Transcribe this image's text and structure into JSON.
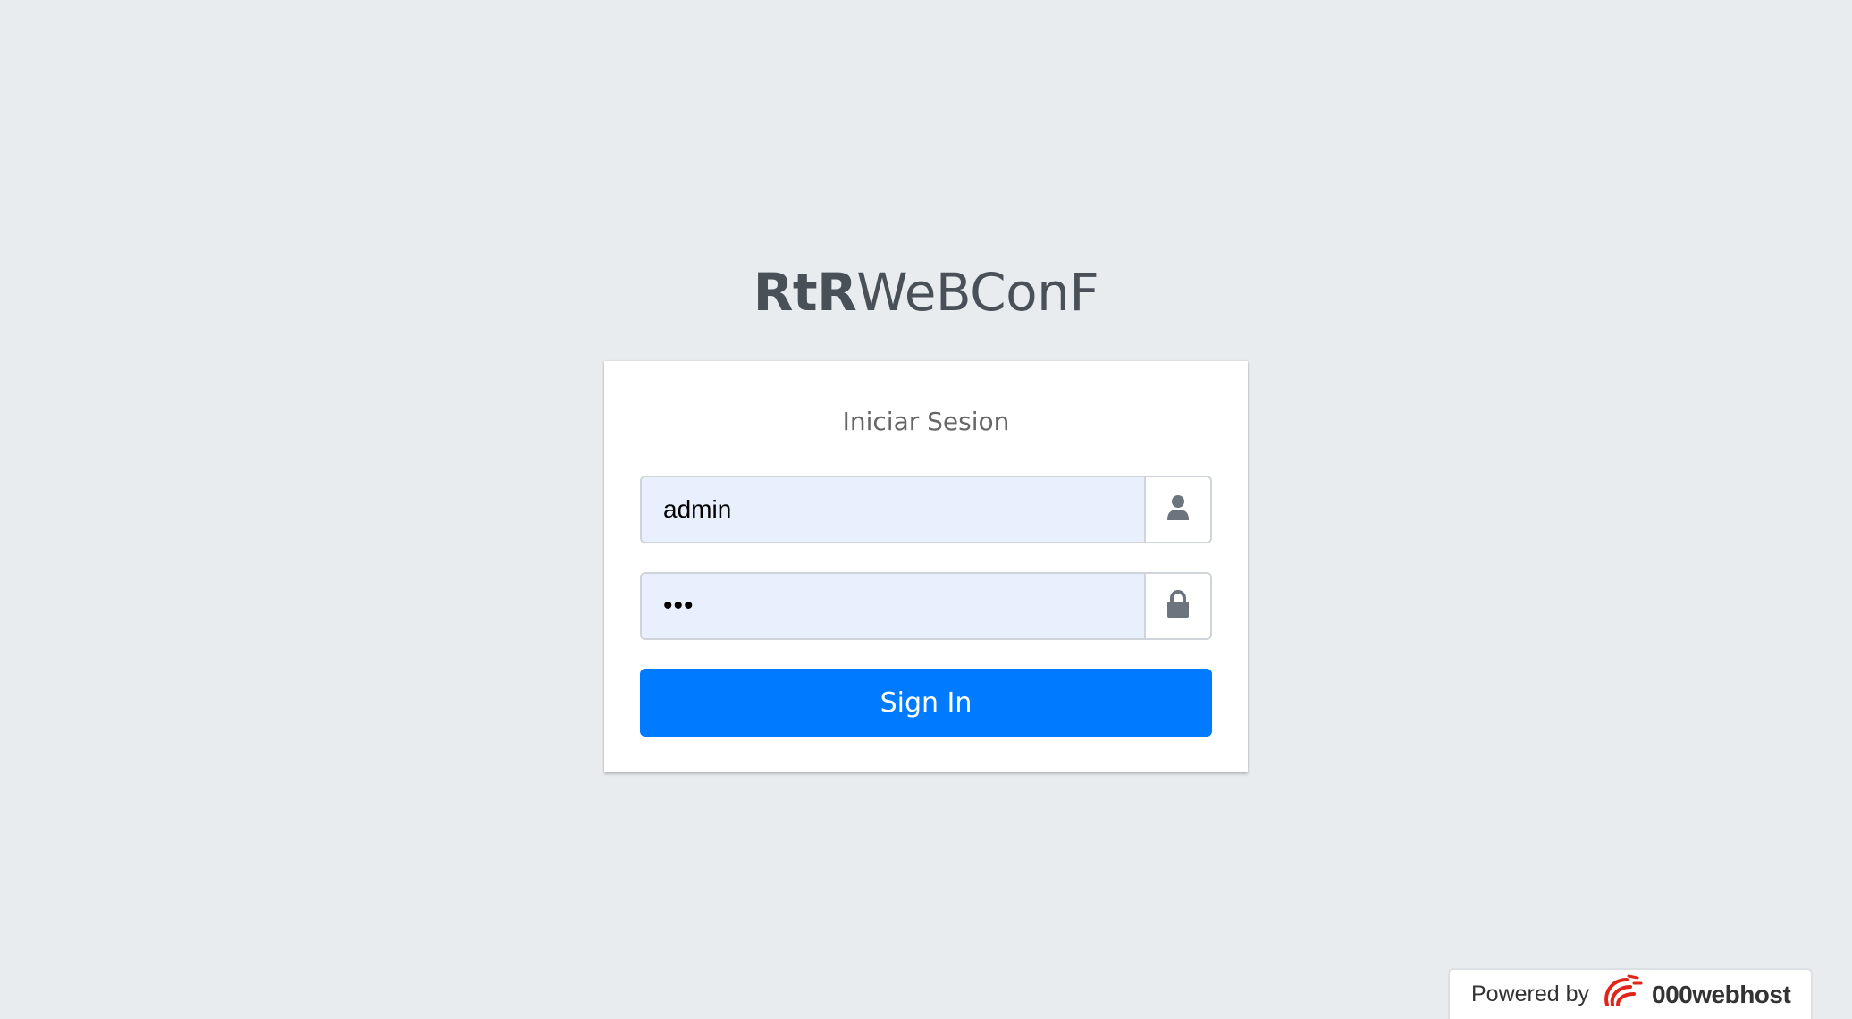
{
  "logo": {
    "bold_part": "RtR",
    "light_part": "WeBConF"
  },
  "login": {
    "message": "Iniciar Sesion",
    "username": {
      "value": "admin",
      "icon": "user-icon"
    },
    "password": {
      "value": "•••",
      "icon": "lock-icon"
    },
    "submit_label": "Sign In"
  },
  "footer": {
    "powered_label": "Powered by",
    "brand": "000webhost",
    "brand_color": "#e1251b"
  },
  "colors": {
    "background": "#e9ecef",
    "primary": "#007bff",
    "autofill": "#e8f0fe"
  }
}
